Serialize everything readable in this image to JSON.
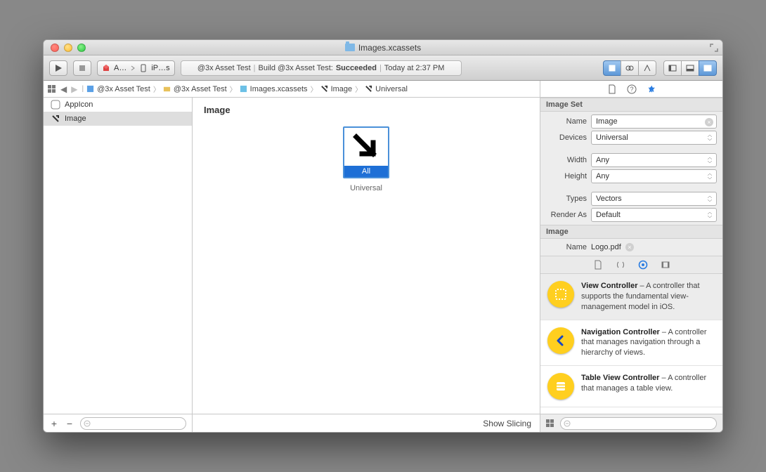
{
  "window": {
    "title": "Images.xcassets"
  },
  "toolbar": {
    "scheme_app": "A…",
    "scheme_dest": "iP…s",
    "status_prefix": "@3x Asset Test",
    "status_build": "Build @3x Asset Test:",
    "status_result": "Succeeded",
    "status_time": "Today at 2:37 PM"
  },
  "breadcrumb": [
    {
      "icon": "project",
      "label": "@3x Asset Test"
    },
    {
      "icon": "folder",
      "label": "@3x Asset Test"
    },
    {
      "icon": "catalog",
      "label": "Images.xcassets"
    },
    {
      "icon": "image",
      "label": "Image"
    },
    {
      "icon": "image",
      "label": "Universal"
    }
  ],
  "assets": [
    {
      "name": "AppIcon",
      "kind": "appicon",
      "selected": false
    },
    {
      "name": "Image",
      "kind": "image",
      "selected": true
    }
  ],
  "editor": {
    "title": "Image",
    "slot_label": "All",
    "slot_sub": "Universal",
    "footer_action": "Show Slicing"
  },
  "inspector": {
    "section1_title": "Image Set",
    "name_label": "Name",
    "name_value": "Image",
    "devices_label": "Devices",
    "devices_value": "Universal",
    "width_label": "Width",
    "width_value": "Any",
    "height_label": "Height",
    "height_value": "Any",
    "types_label": "Types",
    "types_value": "Vectors",
    "render_label": "Render As",
    "render_value": "Default",
    "section2_title": "Image",
    "file_label": "Name",
    "file_value": "Logo.pdf"
  },
  "library": [
    {
      "title": "View Controller",
      "desc": " – A controller that supports the fundamental view-management model in iOS.",
      "icon": "square",
      "selected": true
    },
    {
      "title": "Navigation Controller",
      "desc": " – A controller that manages navigation through a hierarchy of views.",
      "icon": "chevron",
      "selected": false
    },
    {
      "title": "Table View Controller",
      "desc": " – A controller that manages a table view.",
      "icon": "lines",
      "selected": false
    }
  ]
}
